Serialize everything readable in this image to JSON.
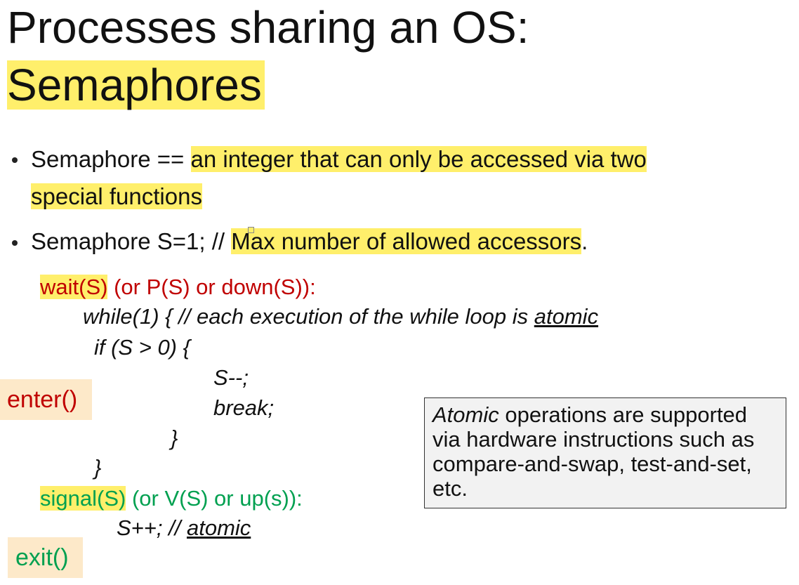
{
  "title": {
    "line1": "Processes sharing an OS:",
    "line2": "Semaphores"
  },
  "bullets": [
    {
      "prefix": "Semaphore == ",
      "highlight_line1": "an integer that can only be accessed via two ",
      "highlight_line2": "special functions"
    },
    {
      "prefix": "Semaphore S=1; // ",
      "highlight": "Max number of allowed accessors",
      "suffix": "."
    }
  ],
  "code": {
    "wait_name": "wait(S)",
    "wait_alt": " (or P(S) or down(S)):",
    "while_line": "while(1) { // each execution of the while loop is ",
    "while_atomic": "atomic",
    "if_line": "if (S > 0) {",
    "decrement": "S--;",
    "break_line": "break;",
    "close_inner": "}",
    "close_outer": "}",
    "signal_name": "signal(S)",
    "signal_alt": " (or V(S) or up(s)):",
    "increment": "S++",
    "increment_comment": "; // ",
    "increment_atomic": "atomic"
  },
  "labels": {
    "enter": "enter()",
    "exit": "exit()"
  },
  "callout": {
    "italic_word": "Atomic",
    "text": " operations are supported via hardware instructions such as compare-and-swap, test-and-set, etc."
  },
  "colors": {
    "highlight": "#ffef6b",
    "red": "#c00000",
    "green": "#00a050",
    "label_bg": "#fde9c9",
    "callout_bg": "#f2f2f2"
  }
}
